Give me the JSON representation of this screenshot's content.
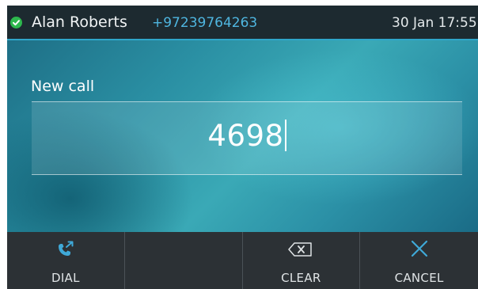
{
  "statusbar": {
    "user_name": "Alan Roberts",
    "user_number": "+97239764263",
    "datetime": "30 Jan 17:55",
    "presence_icon": "check-circle-icon",
    "presence_color": "#2db84d"
  },
  "dialer": {
    "label": "New call",
    "input_value": "4698"
  },
  "softkeys": [
    {
      "label": "DIAL",
      "icon": "dial-phone-icon"
    },
    {
      "label": "",
      "icon": ""
    },
    {
      "label": "CLEAR",
      "icon": "backspace-icon"
    },
    {
      "label": "CANCEL",
      "icon": "close-icon"
    }
  ],
  "colors": {
    "accent": "#4fb6e0",
    "statusbar_bg": "#1d2a30",
    "softkey_bg": "#2c3135"
  }
}
